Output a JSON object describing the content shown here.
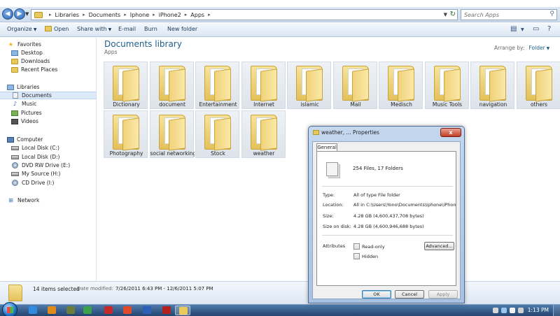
{
  "address": {
    "crumbs": [
      "Libraries",
      "Documents",
      "Iphone",
      "iPhone2",
      "Apps"
    ],
    "search_placeholder": "Search Apps"
  },
  "toolbar": {
    "organize": "Organize",
    "open": "Open",
    "share_with": "Share with",
    "email": "E-mail",
    "burn": "Burn",
    "new_folder": "New folder"
  },
  "navpane": {
    "favorites": "Favorites",
    "desktop": "Desktop",
    "downloads": "Downloads",
    "recent_places": "Recent Places",
    "libraries": "Libraries",
    "documents": "Documents",
    "music": "Music",
    "pictures": "Pictures",
    "videos": "Videos",
    "computer": "Computer",
    "local_c": "Local Disk (C:)",
    "local_d": "Local Disk (D:)",
    "dvd_e": "DVD RW Drive (E:)",
    "my_source": "My Source (H:)",
    "cd_i": "CD Drive (I:)",
    "network": "Network"
  },
  "content": {
    "title": "Documents library",
    "subtitle": "Apps",
    "arrange_label": "Arrange by:",
    "arrange_value": "Folder",
    "folders": [
      "Dictionary",
      "document",
      "Entertainment",
      "Internet",
      "islamic",
      "Mail",
      "Medisch",
      "Music Tools",
      "navigation",
      "others",
      "Photography",
      "social networking",
      "Stock",
      "weather"
    ]
  },
  "details": {
    "count": "14 items selected",
    "modified_label": "Date modified:",
    "modified_value": "7/26/2011 6:43 PM - 12/6/2011 5:07 PM"
  },
  "dialog": {
    "title": "weather, ... Properties",
    "close": "x",
    "tab": "General",
    "summary": "254 Files, 17 Folders",
    "type_label": "Type:",
    "type_value": "All of type File folder",
    "location_label": "Location:",
    "location_value": "All in C:\\Users\\Yono\\Documents\\Iphone\\iPhone2\\A",
    "size_label": "Size:",
    "size_value": "4.28 GB (4,600,437,708 bytes)",
    "size_disk_label": "Size on disk:",
    "size_disk_value": "4.28 GB (4,600,946,688 bytes)",
    "attributes_label": "Attributes",
    "readonly_label": "Read-only",
    "hidden_label": "Hidden",
    "advanced": "Advanced...",
    "ok": "OK",
    "cancel": "Cancel",
    "apply": "Apply"
  },
  "taskbar": {
    "clock": "1:13 PM",
    "apps": [
      {
        "icon": "ie-icon",
        "color": "#2f8be0"
      },
      {
        "icon": "media-player-icon",
        "color": "#e08a1c"
      },
      {
        "icon": "tool-icon",
        "color": "#6a7d3a"
      },
      {
        "icon": "app-green-icon",
        "color": "#3aa04a"
      },
      {
        "icon": "pdf-icon",
        "color": "#c62828"
      },
      {
        "icon": "chrome-icon",
        "color": "#e04a2c"
      },
      {
        "icon": "word-icon",
        "color": "#2b5fb8"
      },
      {
        "icon": "app-red-icon",
        "color": "#b32020"
      },
      {
        "icon": "explorer-icon",
        "color": "#e8c95b"
      }
    ]
  }
}
